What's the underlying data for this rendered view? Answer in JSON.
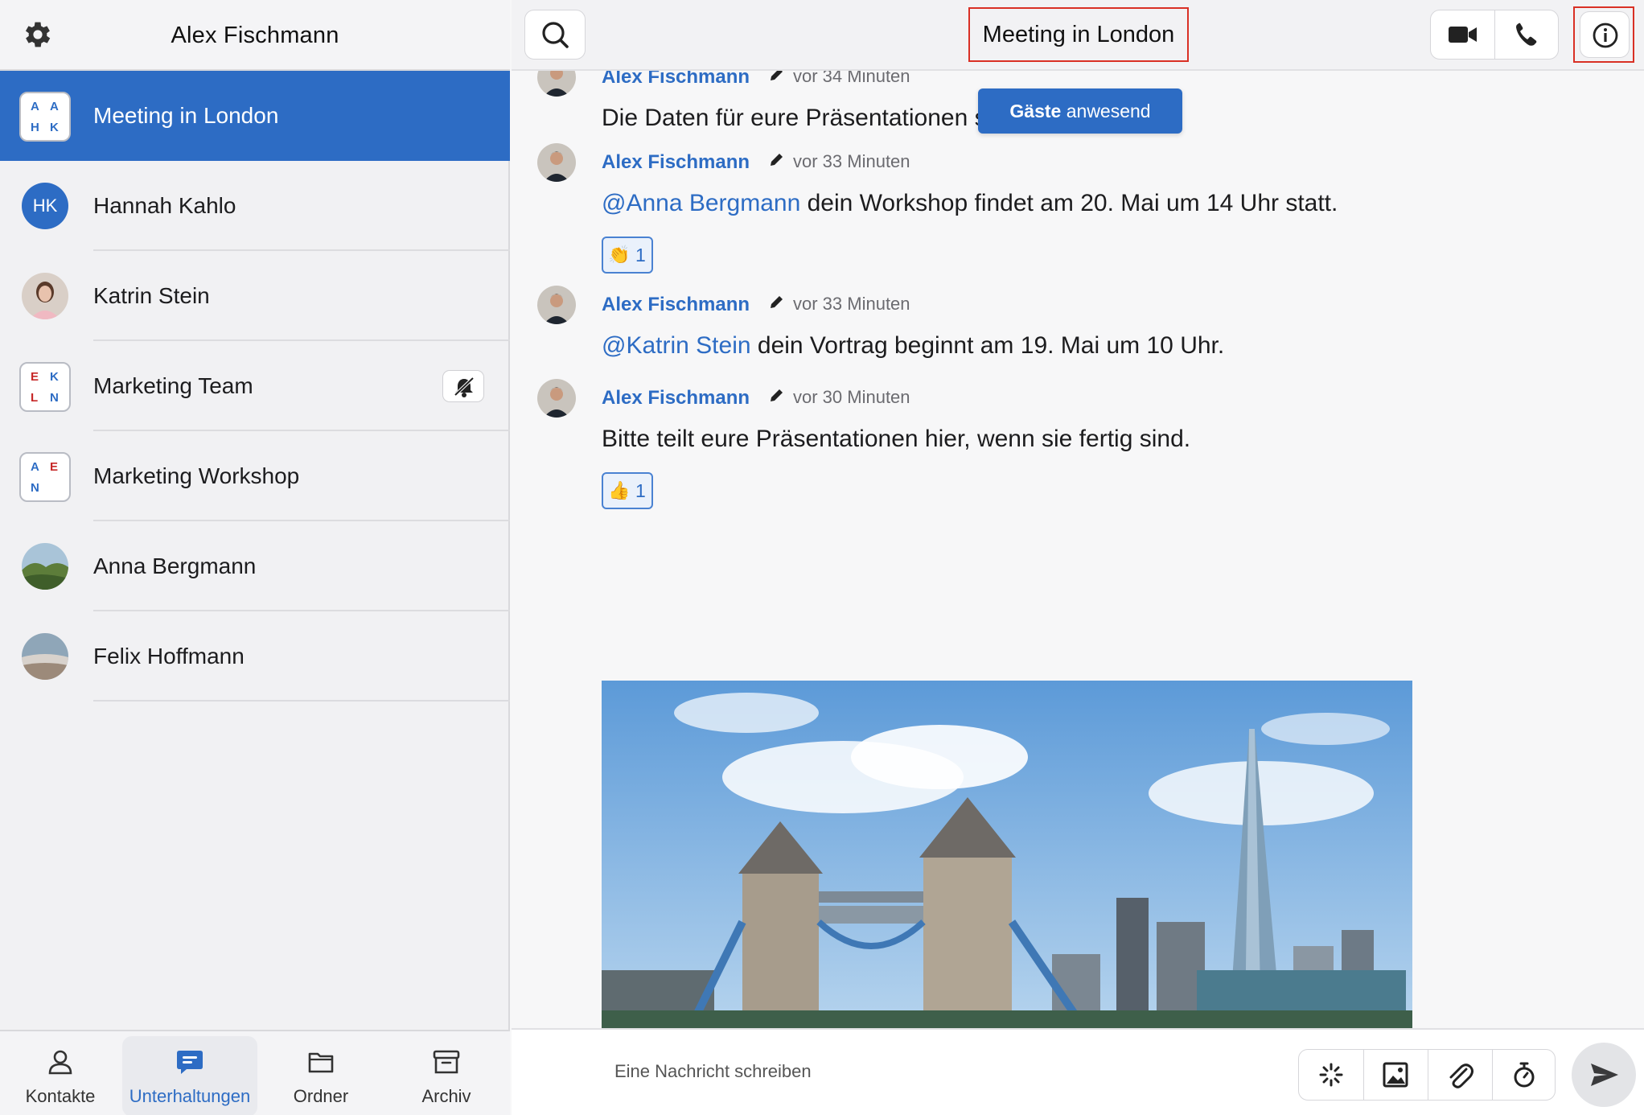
{
  "app": {
    "user_name": "Alex Fischmann"
  },
  "sidebar": {
    "conversations": [
      {
        "label": "Meeting in London",
        "avatar_type": "group-tile",
        "tile_letters": [
          "A",
          "A",
          "H",
          "K"
        ],
        "active": true
      },
      {
        "label": "Hannah Kahlo",
        "avatar_type": "initials",
        "initials": "HK"
      },
      {
        "label": "Katrin Stein",
        "avatar_type": "photo"
      },
      {
        "label": "Marketing Team",
        "avatar_type": "group-tile",
        "tile_letters": [
          "E",
          "K",
          "L",
          "N"
        ],
        "muted": true
      },
      {
        "label": "Marketing Workshop",
        "avatar_type": "group-tile",
        "tile_letters": [
          "A",
          "E",
          "N"
        ]
      },
      {
        "label": "Anna Bergmann",
        "avatar_type": "photo"
      },
      {
        "label": "Felix Hoffmann",
        "avatar_type": "photo"
      }
    ]
  },
  "bottom_nav": {
    "items": [
      {
        "label": "Kontakte",
        "icon": "person-icon"
      },
      {
        "label": "Unterhaltungen",
        "icon": "chat-bubble-icon",
        "active": true
      },
      {
        "label": "Ordner",
        "icon": "folder-icon"
      },
      {
        "label": "Archiv",
        "icon": "archive-box-icon"
      }
    ]
  },
  "chat": {
    "title": "Meeting in London",
    "guest_badge_bold": "Gäste",
    "guest_badge_rest": " anwesend",
    "messages": [
      {
        "author": "Alex Fischmann",
        "time": "vor 34 Minuten",
        "text": "Die Daten für eure Präsentationen stehen fest."
      },
      {
        "author": "Alex Fischmann",
        "time": "vor 33 Minuten",
        "mention": "@Anna Bergmann",
        "text": " dein Workshop findet am 20. Mai um 14 Uhr statt.",
        "reaction": {
          "emoji": "👏",
          "count": "1"
        }
      },
      {
        "author": "Alex Fischmann",
        "time": "vor 33 Minuten",
        "mention": "@Katrin Stein",
        "text": " dein Vortrag beginnt am 19. Mai um 10 Uhr."
      },
      {
        "author": "Alex Fischmann",
        "time": "vor 30 Minuten",
        "text": "Bitte teilt eure Präsentationen hier, wenn sie fertig sind.",
        "reaction": {
          "emoji": "👍",
          "count": "1"
        }
      }
    ],
    "image_alt": "Tower Bridge and The Shard, London"
  },
  "composer": {
    "placeholder": "Eine Nachricht schreiben",
    "tools": [
      "sparkle-icon",
      "image-icon",
      "paperclip-icon",
      "timer-icon"
    ]
  },
  "colors": {
    "accent": "#2d6cc4",
    "highlight_box": "#d93025",
    "tile_blue": "#2d6cc4",
    "tile_red": "#c62828"
  }
}
